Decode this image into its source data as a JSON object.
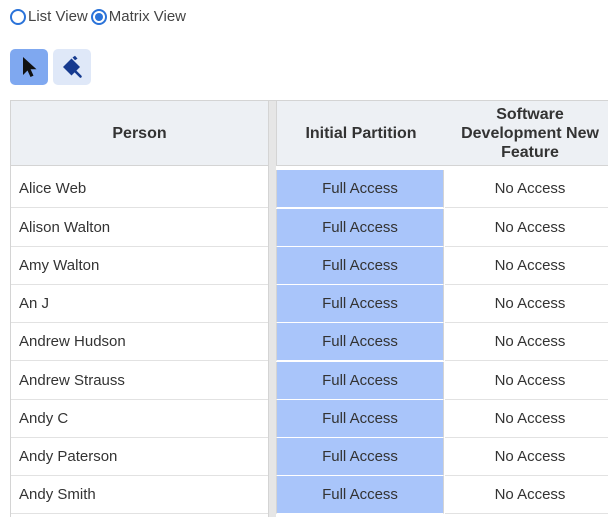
{
  "view_toggle": {
    "list_label": "List View",
    "matrix_label": "Matrix View",
    "selected": "Matrix View"
  },
  "toolbar": {
    "select_tool_icon": "cursor-arrow-icon",
    "fill_tool_icon": "paint-bucket-icon"
  },
  "colors": {
    "accent": "#2b73d9",
    "selected_column": "#a9c5fa",
    "active_tool": "#7fa8f0",
    "header_bg": "#edf0f4"
  },
  "table": {
    "headers": {
      "person": "Person",
      "initial": "Initial Partition",
      "software": "Software Development New Feature"
    },
    "rows": [
      {
        "person": "Alice Web",
        "initial": "Full Access",
        "software": "No Access"
      },
      {
        "person": "Alison Walton",
        "initial": "Full Access",
        "software": "No Access"
      },
      {
        "person": "Amy Walton",
        "initial": "Full Access",
        "software": "No Access"
      },
      {
        "person": "An J",
        "initial": "Full Access",
        "software": "No Access"
      },
      {
        "person": "Andrew Hudson",
        "initial": "Full Access",
        "software": "No Access"
      },
      {
        "person": "Andrew Strauss",
        "initial": "Full Access",
        "software": "No Access"
      },
      {
        "person": "Andy C",
        "initial": "Full Access",
        "software": "No Access"
      },
      {
        "person": "Andy Paterson",
        "initial": "Full Access",
        "software": "No Access"
      },
      {
        "person": "Andy Smith",
        "initial": "Full Access",
        "software": "No Access"
      }
    ]
  }
}
